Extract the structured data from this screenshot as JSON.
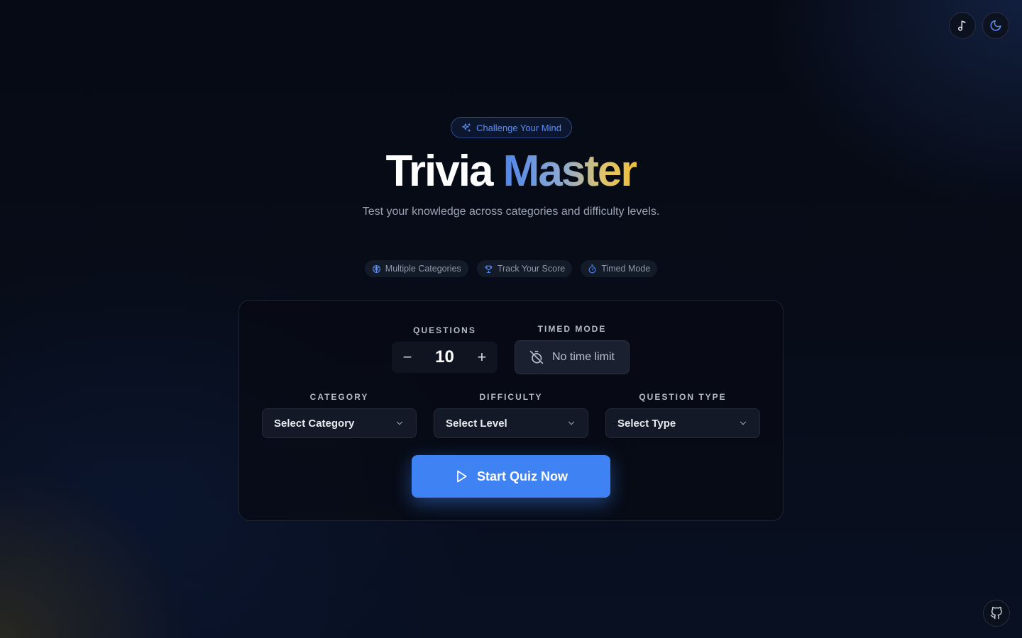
{
  "controls": {
    "music_icon": "music-note-icon",
    "theme_icon": "moon-icon",
    "github_icon": "github-icon"
  },
  "hero": {
    "badge_icon": "sparkles-icon",
    "badge": "Challenge Your Mind",
    "title_part1": "Trivia",
    "title_part2": "Master",
    "subtitle": "Test your knowledge across categories and difficulty levels."
  },
  "features": [
    {
      "icon": "brain-icon",
      "label": "Multiple Categories"
    },
    {
      "icon": "trophy-icon",
      "label": "Track Your Score"
    },
    {
      "icon": "timer-icon",
      "label": "Timed Mode"
    }
  ],
  "setup": {
    "questions": {
      "label": "QUESTIONS",
      "value": "10",
      "decrement": "−",
      "increment": "+"
    },
    "timed_mode": {
      "label": "TIMED MODE",
      "value": "No time limit",
      "icon": "timer-off-icon"
    },
    "category": {
      "label": "CATEGORY",
      "value": "Select Category"
    },
    "difficulty": {
      "label": "DIFFICULTY",
      "value": "Select Level"
    },
    "question_type": {
      "label": "QUESTION TYPE",
      "value": "Select Type"
    },
    "start_label": "Start Quiz Now",
    "start_icon": "play-icon"
  },
  "colors": {
    "background": "#060a14",
    "accent": "#3f82f3",
    "badge_text": "#5d8ef0",
    "title_gradient": [
      "#4f86ec",
      "#8eaad0",
      "#e0c46a",
      "#f0bf3c"
    ]
  }
}
